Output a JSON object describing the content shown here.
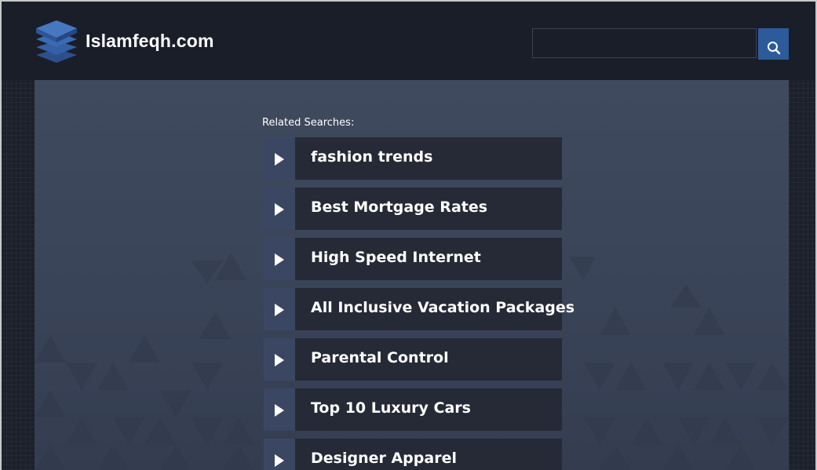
{
  "header": {
    "site_name": "Islamfeqh.com",
    "search": {
      "value": "",
      "placeholder": "",
      "button_icon": "search-icon"
    },
    "logo_icon": "stacked-layers-icon"
  },
  "main": {
    "related_label": "Related Searches:",
    "links": [
      {
        "label": "fashion trends",
        "icon": "play-arrow-icon"
      },
      {
        "label": "Best Mortgage Rates",
        "icon": "play-arrow-icon"
      },
      {
        "label": "High Speed Internet",
        "icon": "play-arrow-icon"
      },
      {
        "label": "All Inclusive Vacation Packages",
        "icon": "play-arrow-icon"
      },
      {
        "label": "Parental Control",
        "icon": "play-arrow-icon"
      },
      {
        "label": "Top 10 Luxury Cars",
        "icon": "play-arrow-icon"
      },
      {
        "label": "Designer Apparel",
        "icon": "play-arrow-icon"
      }
    ]
  },
  "colors": {
    "header_bg": "#1a1e29",
    "panel_bg": "#3d475b",
    "link_bg": "#252a36",
    "arrow_bg": "#3b4762",
    "accent": "#2d5a9b",
    "text": "#ffffff"
  }
}
